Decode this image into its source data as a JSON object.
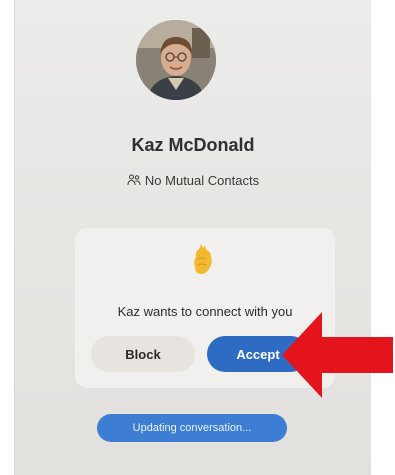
{
  "profile": {
    "name": "Kaz McDonald",
    "mutual_contacts": "No Mutual Contacts",
    "mutual_icon": "people-icon",
    "avatar": "profile-photo"
  },
  "request_card": {
    "emoji": "waving-hand-emoji",
    "message": "Kaz wants to connect with you",
    "block_label": "Block",
    "accept_label": "Accept"
  },
  "status": {
    "text": "Updating conversation..."
  },
  "annotation": {
    "arrow_color": "#e3141b",
    "arrow": "arrow-left-icon"
  },
  "colors": {
    "accent": "#2e6cc3",
    "status_pill": "#3d7ed2",
    "card_background": "#f1f0ee"
  }
}
